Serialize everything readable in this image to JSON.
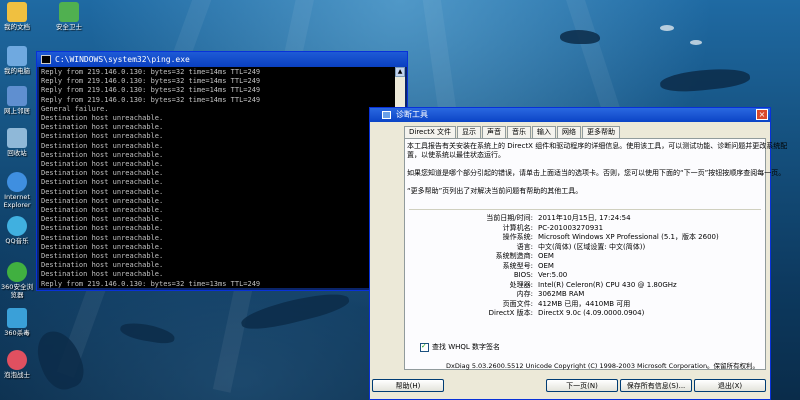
{
  "desktop": {
    "icons": [
      {
        "label": "我的文档",
        "color": "#f0c040"
      },
      {
        "label": "我的电脑",
        "color": "#6fa9e0"
      },
      {
        "label": "网上邻居",
        "color": "#5f8fd0"
      },
      {
        "label": "回收站",
        "color": "#8fb8d8"
      },
      {
        "label": "Internet Explorer",
        "color": "#3f8fe0"
      },
      {
        "label": "QQ音乐",
        "color": "#40b0e0"
      },
      {
        "label": "360安全浏览器",
        "color": "#40b040"
      },
      {
        "label": "360杀毒",
        "color": "#3aa0d8"
      },
      {
        "label": "泡泡战士",
        "color": "#e05060"
      },
      {
        "label": "安全卫士",
        "color": "#50b050"
      }
    ]
  },
  "cmd": {
    "title": "C:\\WINDOWS\\system32\\ping.exe",
    "lines": [
      "Reply from 219.146.0.130: bytes=32 time=14ms TTL=249",
      "Reply from 219.146.0.130: bytes=32 time=14ms TTL=249",
      "Reply from 219.146.0.130: bytes=32 time=14ms TTL=249",
      "Reply from 219.146.0.130: bytes=32 time=14ms TTL=249",
      "General failure.",
      "Destination host unreachable.",
      "Destination host unreachable.",
      "Destination host unreachable.",
      "Destination host unreachable.",
      "Destination host unreachable.",
      "Destination host unreachable.",
      "Destination host unreachable.",
      "Destination host unreachable.",
      "Destination host unreachable.",
      "Destination host unreachable.",
      "Destination host unreachable.",
      "Destination host unreachable.",
      "Destination host unreachable.",
      "Destination host unreachable.",
      "Destination host unreachable.",
      "Destination host unreachable.",
      "Destination host unreachable.",
      "Destination host unreachable.",
      "Reply from 219.146.0.130: bytes=32 time=13ms TTL=249"
    ]
  },
  "dx": {
    "title": "诊断工具",
    "tabs": [
      "DirectX 文件",
      "显示",
      "声音",
      "音乐",
      "输入",
      "网络",
      "更多帮助"
    ],
    "intro": [
      "本工具报告有关安装在系统上的 DirectX 组件和驱动程序的详细信息。使用该工具，可以测试功能、诊断问题并更改系统配",
      "置，以使系统以最佳状态运行。",
      "如果您知道是哪个部分引起的错误，请单击上面适当的选项卡。否则，您可以使用下面的“下一页”按钮按顺序查阅每一页。",
      "“更多帮助”页列出了对解决当前问题有帮助的其他工具。"
    ],
    "sysinfo": [
      {
        "label": "当前日期/时间:",
        "value": "2011年10月15日, 17:24:54"
      },
      {
        "label": "计算机名:",
        "value": "PC-201003270931"
      },
      {
        "label": "操作系统:",
        "value": "Microsoft Windows XP Professional (5.1，版本 2600)"
      },
      {
        "label": "语言:",
        "value": "中文(简体) (区域设置: 中文(简体))"
      },
      {
        "label": "系统制造商:",
        "value": "OEM"
      },
      {
        "label": "系统型号:",
        "value": "OEM"
      },
      {
        "label": "BIOS:",
        "value": "Ver:5.00"
      },
      {
        "label": "处理器:",
        "value": "Intel(R) Celeron(R) CPU          430  @ 1.80GHz"
      },
      {
        "label": "内存:",
        "value": "3062MB RAM"
      },
      {
        "label": "页面文件:",
        "value": "412MB 已用，4410MB 可用"
      },
      {
        "label": "DirectX 版本:",
        "value": "DirectX 9.0c (4.09.0000.0904)"
      }
    ],
    "checkbox_label": "查找 WHQL 数字签名",
    "copyright": "DxDiag 5.03.2600.5512 Unicode  Copyright (C) 1998-2003 Microsoft Corporation。保留所有权利。",
    "buttons": {
      "help": "帮助(H)",
      "next": "下一页(N)",
      "save": "保存所有信息(S)...",
      "exit": "退出(X)"
    },
    "close_glyph": "×"
  }
}
